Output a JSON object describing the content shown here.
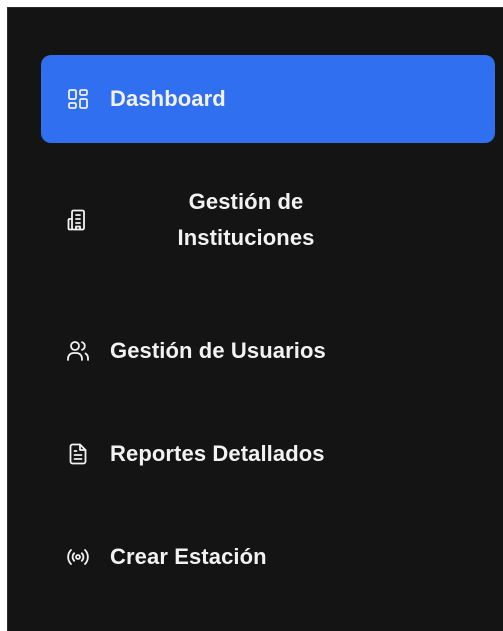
{
  "sidebar": {
    "items": [
      {
        "label": "Dashboard",
        "icon": "dashboard-grid-icon",
        "active": true
      },
      {
        "label": "Gestión de Instituciones",
        "icon": "building-icon",
        "active": false
      },
      {
        "label": "Gestión de Usuarios",
        "icon": "users-icon",
        "active": false
      },
      {
        "label": "Reportes Detallados",
        "icon": "file-text-icon",
        "active": false
      },
      {
        "label": "Crear Estación",
        "icon": "radio-broadcast-icon",
        "active": false
      }
    ]
  },
  "colors": {
    "sidebar_bg": "#141414",
    "active_bg": "#2f6ff0",
    "text": "#f2f2f2"
  }
}
